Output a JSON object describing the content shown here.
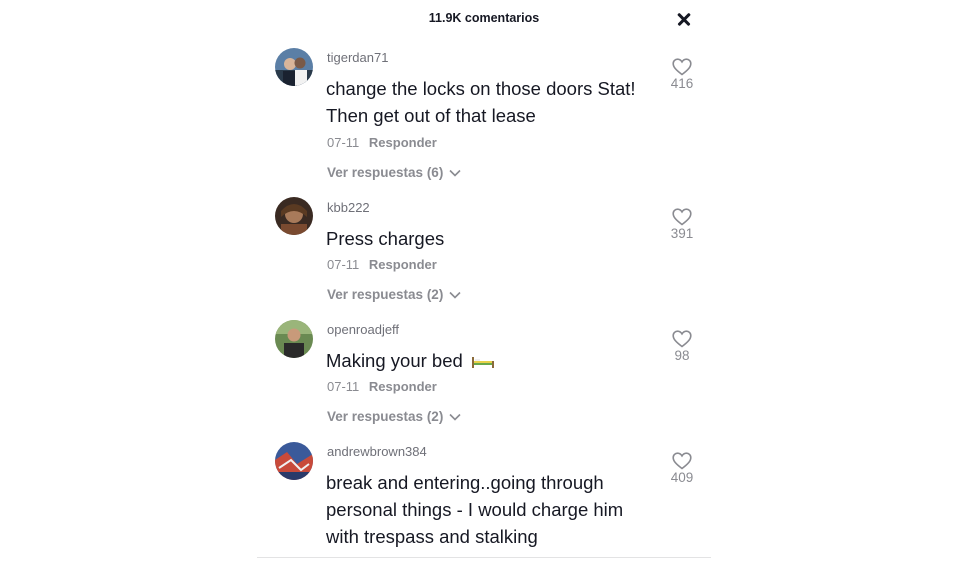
{
  "header": {
    "comment_count": "11.9K comentarios",
    "close_icon": "close-icon"
  },
  "comments": [
    {
      "username": "tigerdan71",
      "text": "change the locks on those doors Stat! Then get out of that lease",
      "date": "07-11",
      "reply_label": "Responder",
      "replies_label": "Ver respuestas (6)",
      "likes": "416",
      "avatar_color": "#4a6a8c"
    },
    {
      "username": "kbb222",
      "text": "Press charges",
      "date": "07-11",
      "reply_label": "Responder",
      "replies_label": "Ver respuestas (2)",
      "likes": "391",
      "avatar_color": "#6a4a38"
    },
    {
      "username": "openroadjeff",
      "text": "Making your bed",
      "date": "07-11",
      "reply_label": "Responder",
      "replies_label": "Ver respuestas (2)",
      "likes": "98",
      "avatar_color": "#4e6a3a"
    },
    {
      "username": "andrewbrown384",
      "text": "break and entering..going through personal things - I would charge him with trespass and stalking",
      "likes": "409",
      "avatar_color": "#3a5a9a"
    }
  ]
}
